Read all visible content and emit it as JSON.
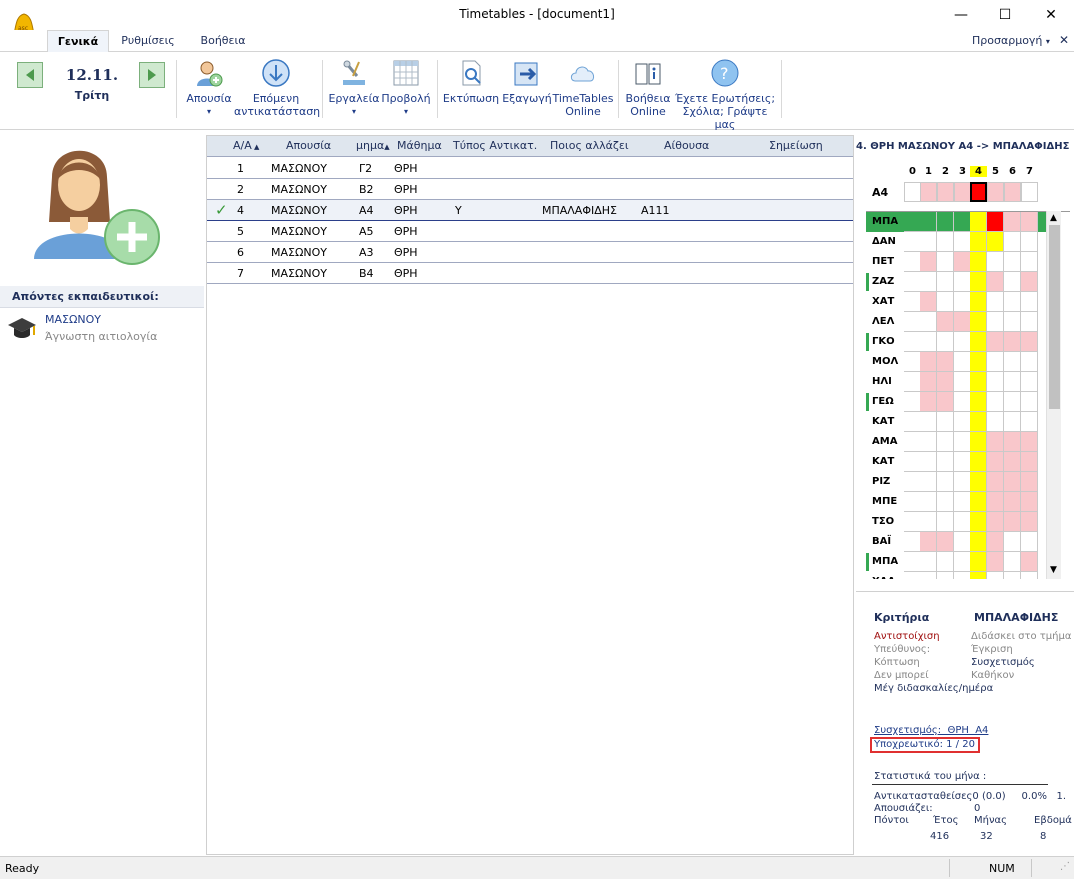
{
  "window": {
    "title": "Timetables - [document1]"
  },
  "tabs": {
    "general": "Γενικά",
    "settings": "Ρυθμίσεις",
    "help": "Βοήθεια",
    "customize": "Προσαρμογή"
  },
  "date": {
    "day": "12.11.",
    "weekday": "Τρίτη"
  },
  "ribbon": {
    "absence": "Απουσία",
    "next_line1": "Επόμενη",
    "next_line2": "αντικατάσταση",
    "tools": "Εργαλεία",
    "view": "Προβολή",
    "print": "Εκτύπωση",
    "export": "Εξαγωγή",
    "online_line1": "TimeTables",
    "online_line2": "Online",
    "helponline_line1": "Βοήθεια",
    "helponline_line2": "Online",
    "questions_line1": "Έχετε Ερωτήσεις;",
    "questions_line2": "Σχόλια; Γράψτε μας"
  },
  "left": {
    "absent_header": "Απόντες εκπαιδευτικοί:",
    "teacher_name": "ΜΑΣΩΝΟΥ",
    "teacher_reason": "Άγνωστη αιτιολογία"
  },
  "table": {
    "headers": {
      "aa": "Α/Α",
      "absence": "Απουσία",
      "class": "μημα",
      "subject": "Μάθημα",
      "type": "Τύπος Αντικατ.",
      "who": "Ποιος αλλάζει",
      "room": "Αίθουσα",
      "note": "Σημείωση"
    },
    "rows": [
      {
        "aa": "1",
        "absence": "ΜΑΣΩΝΟΥ",
        "class": "Γ2",
        "subject": "ΘΡΗ",
        "type": "",
        "who": "",
        "room": ""
      },
      {
        "aa": "2",
        "absence": "ΜΑΣΩΝΟΥ",
        "class": "Β2",
        "subject": "ΘΡΗ",
        "type": "",
        "who": "",
        "room": ""
      },
      {
        "aa": "4",
        "absence": "ΜΑΣΩΝΟΥ",
        "class": "Α4",
        "subject": "ΘΡΗ",
        "type": "Υ",
        "who": "ΜΠΑΛΑΦΙΔΗΣ",
        "room": "Α111"
      },
      {
        "aa": "5",
        "absence": "ΜΑΣΩΝΟΥ",
        "class": "Α5",
        "subject": "ΘΡΗ",
        "type": "",
        "who": "",
        "room": ""
      },
      {
        "aa": "6",
        "absence": "ΜΑΣΩΝΟΥ",
        "class": "Α3",
        "subject": "ΘΡΗ",
        "type": "",
        "who": "",
        "room": ""
      },
      {
        "aa": "7",
        "absence": "ΜΑΣΩΝΟΥ",
        "class": "Β4",
        "subject": "ΘΡΗ",
        "type": "",
        "who": "",
        "room": ""
      }
    ]
  },
  "right": {
    "title": "4. ΘΡΗ ΜΑΣΩΝΟΥ Α4 -> ΜΠΑΛΑΦΙΔΗΣ",
    "periods": [
      "0",
      "1",
      "2",
      "3",
      "4",
      "5",
      "6",
      "7"
    ],
    "class_row": "Α4",
    "teachers": [
      "ΜΠΑ",
      "ΔΑΝ",
      "ΠΕΤ",
      "ΖΑΖ",
      "ΧΑΤ",
      "ΛΕΛ",
      "ΓΚΟ",
      "ΜΟΛ",
      "ΗΛΙ",
      "ΓΕΩ",
      "ΚΑΤ",
      "ΑΜΑ",
      "ΚΑΤ",
      "ΡΙΖ",
      "ΜΠΕ",
      "ΤΣΟ",
      "ΒΑΪ",
      "ΜΠΑ",
      "ΧΑΛ"
    ],
    "criteria_label": "Κριτήρια",
    "criteria_teacher": "ΜΠΑΛΑΦΙΔΗΣ",
    "crit_left": [
      "Αντιστοίχιση",
      "Υπεύθυνος:",
      "Κόπτωση",
      "Δεν μπορεί"
    ],
    "crit_right": [
      "Διδάσκει στο τμήμα",
      "Έγκριση",
      "Συσχετισμός",
      "Καθήκον"
    ],
    "max_lessons": "Μέγ διδασκαλίες/ημέρα",
    "correlation": "Συσχετισμός:  ΘΡΗ  Α4",
    "mandatory": "Υποχρεωτικό: 1 / 20",
    "stats_title": "Στατιστικά του μήνα :",
    "stats_sub": "Αντικατασταθείσες0 (0.0)     0.0%   1.",
    "stats_abs": "Απουσιάζει:",
    "stats_abs_val": "0",
    "points": "Πόντοι",
    "year": "Έτος",
    "month": "Μήνας",
    "week": "Εβδομά",
    "year_val": "416",
    "month_val": "32",
    "week_val": "8"
  },
  "status": {
    "ready": "Ready",
    "num": "NUM"
  },
  "colors": {
    "pink": "#f9c7cb",
    "green": "#35a853",
    "yellow": "#ffff00",
    "red": "#ff0000",
    "blue_text": "#1f3c88"
  }
}
